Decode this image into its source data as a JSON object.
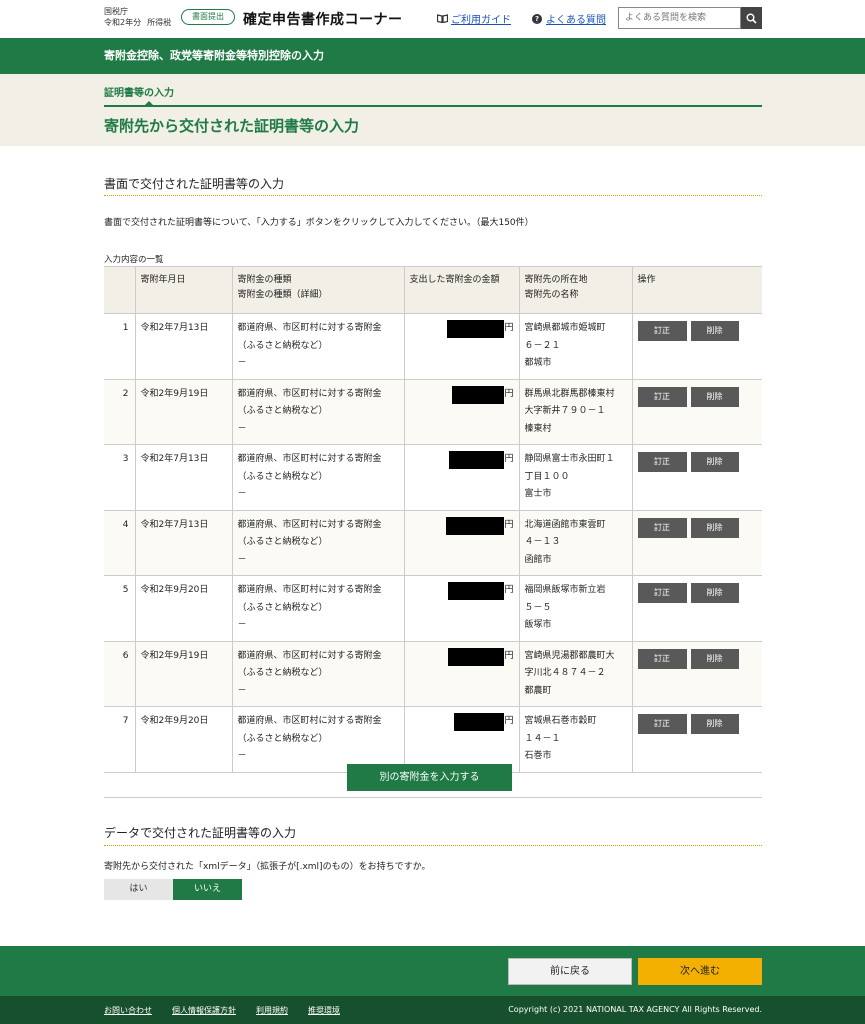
{
  "header": {
    "agency": "国税庁",
    "year": "令和2年分",
    "tax_type": "所得税",
    "badge": "書面提出",
    "app_title": "確定申告書作成コーナー",
    "guide_link": "ご利用ガイド",
    "faq_link": "よくある質問",
    "search_placeholder": "よくある質問を検索"
  },
  "banner": {
    "title": "寄附金控除、政党等寄附金等特別控除の入力"
  },
  "step": {
    "label": "証明書等の入力",
    "page_title": "寄附先から交付された証明書等の入力"
  },
  "paper_section": {
    "title": "書面で交付された証明書等の入力",
    "description": "書面で交付された証明書等について、「入力する」ボタンをクリックして入力してください。（最大150件）",
    "list_label": "入力内容の一覧",
    "columns": {
      "date": "寄附年月日",
      "type_line1": "寄附金の種類",
      "type_line2": "寄附金の種類（詳細）",
      "amount": "支出した寄附金の金額",
      "recipient_line1": "寄附先の所在地",
      "recipient_line2": "寄附先の名称",
      "actions": "操作"
    },
    "rows": [
      {
        "no": "1",
        "date": "令和2年7月13日",
        "type1": "都道府県、市区町村に対する寄附金",
        "type2": "（ふるさと納税など）",
        "type3": "－",
        "yen": "円",
        "addr1": "宮崎県都城市姫城町",
        "addr2": "６－２１",
        "addr3": "都城市",
        "edit": "訂正",
        "delete": "削除"
      },
      {
        "no": "2",
        "date": "令和2年9月19日",
        "type1": "都道府県、市区町村に対する寄附金",
        "type2": "（ふるさと納税など）",
        "type3": "－",
        "yen": "円",
        "addr1": "群馬県北群馬郡榛東村",
        "addr2": "大字新井７９０－１",
        "addr3": "榛東村",
        "edit": "訂正",
        "delete": "削除"
      },
      {
        "no": "3",
        "date": "令和2年7月13日",
        "type1": "都道府県、市区町村に対する寄附金",
        "type2": "（ふるさと納税など）",
        "type3": "－",
        "yen": "円",
        "addr1": "静岡県富士市永田町１",
        "addr2": "丁目１００",
        "addr3": "富士市",
        "edit": "訂正",
        "delete": "削除"
      },
      {
        "no": "4",
        "date": "令和2年7月13日",
        "type1": "都道府県、市区町村に対する寄附金",
        "type2": "（ふるさと納税など）",
        "type3": "－",
        "yen": "円",
        "addr1": "北海道函館市東雲町",
        "addr2": "４－１３",
        "addr3": "函館市",
        "edit": "訂正",
        "delete": "削除"
      },
      {
        "no": "5",
        "date": "令和2年9月20日",
        "type1": "都道府県、市区町村に対する寄附金",
        "type2": "（ふるさと納税など）",
        "type3": "－",
        "yen": "円",
        "addr1": "福岡県飯塚市新立岩",
        "addr2": "５－５",
        "addr3": "飯塚市",
        "edit": "訂正",
        "delete": "削除"
      },
      {
        "no": "6",
        "date": "令和2年9月19日",
        "type1": "都道府県、市区町村に対する寄附金",
        "type2": "（ふるさと納税など）",
        "type3": "－",
        "yen": "円",
        "addr1": "宮崎県児湯郡都農町大",
        "addr2": "字川北４８７４－２",
        "addr3": "都農町",
        "edit": "訂正",
        "delete": "削除"
      },
      {
        "no": "7",
        "date": "令和2年9月20日",
        "type1": "都道府県、市区町村に対する寄附金",
        "type2": "（ふるさと納税など）",
        "type3": "－",
        "yen": "円",
        "addr1": "宮城県石巻市穀町",
        "addr2": "１４－１",
        "addr3": "石巻市",
        "edit": "訂正",
        "delete": "削除"
      }
    ],
    "add_button": "別の寄附金を入力する"
  },
  "data_section": {
    "title": "データで交付された証明書等の入力",
    "question": "寄附先から交付された「xmlデータ」（拡張子が[.xml]のもの）をお持ちですか。",
    "yes": "はい",
    "no": "いいえ",
    "selected": "いいえ"
  },
  "footer": {
    "back": "前に戻る",
    "next": "次へ進む",
    "links": [
      "お問い合わせ",
      "個人情報保護方針",
      "利用規約",
      "推奨環境"
    ],
    "copyright": "Copyright (c) 2021 NATIONAL TAX AGENCY All Rights Reserved."
  },
  "colors": {
    "brand_green": "#1f7a45",
    "next_yellow": "#f4b000",
    "link_blue": "#1a53b8"
  }
}
